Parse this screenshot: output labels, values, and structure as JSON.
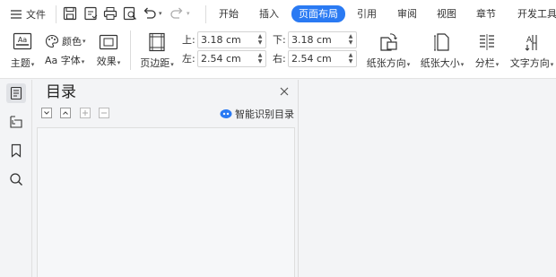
{
  "menu": {
    "file_label": "文件"
  },
  "tabs": [
    {
      "label": "开始"
    },
    {
      "label": "插入"
    },
    {
      "label": "页面布局",
      "active": true
    },
    {
      "label": "引用"
    },
    {
      "label": "审阅"
    },
    {
      "label": "视图"
    },
    {
      "label": "章节"
    },
    {
      "label": "开发工具"
    }
  ],
  "ribbon": {
    "theme_label": "主题",
    "color_label": "颜色",
    "font_label": "Aa 字体",
    "effect_label": "效果",
    "margins_label": "页边距",
    "top_label": "上:",
    "top_value": "3.18 cm",
    "bottom_label": "下:",
    "bottom_value": "3.18 cm",
    "left_label": "左:",
    "left_value": "2.54 cm",
    "right_label": "右:",
    "right_value": "2.54 cm",
    "orientation_label": "纸张方向",
    "size_label": "纸张大小",
    "columns_label": "分栏",
    "text_direction_label": "文字方向"
  },
  "toc_panel": {
    "title": "目录",
    "smart_label": "智能识别目录"
  },
  "colors": {
    "accent": "#2a7af3",
    "ribbon_bg": "#ffffff",
    "workspace_bg": "#f3f4f6"
  }
}
